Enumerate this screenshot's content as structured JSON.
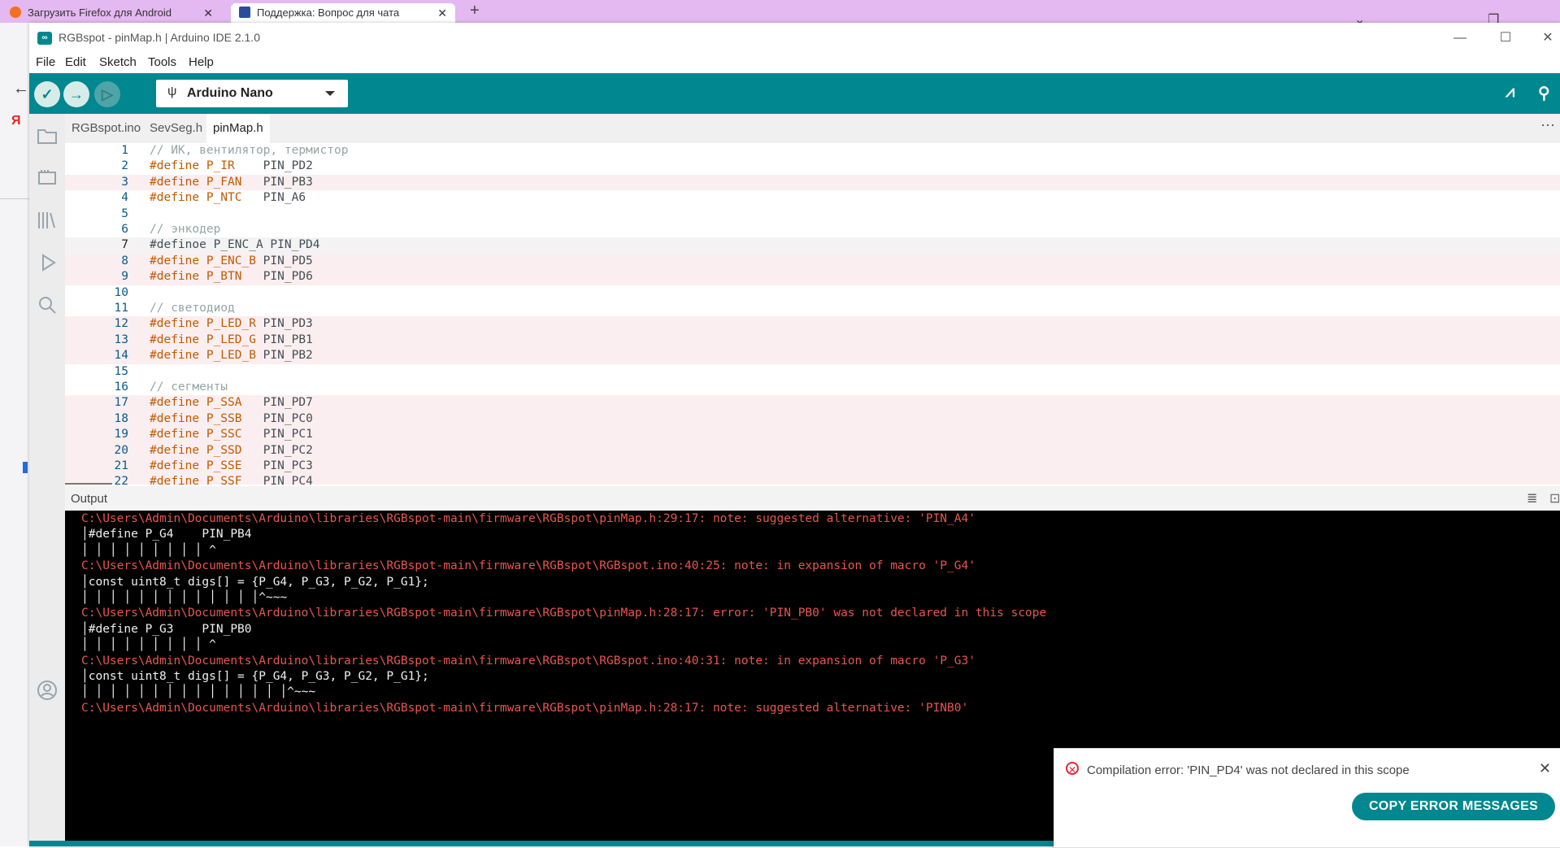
{
  "browser": {
    "tab1_title": "Загрузить Firefox для Android",
    "tab2_title": "Поддержка: Вопрос для чата",
    "tab_close": "✕",
    "new_tab": "+"
  },
  "window": {
    "title": "RGBspot - pinMap.h | Arduino IDE 2.1.0",
    "app_badge": "∞"
  },
  "menu": [
    "File",
    "Edit",
    "Sketch",
    "Tools",
    "Help"
  ],
  "toolbar": {
    "board": "Arduino Nano"
  },
  "tabs": [
    {
      "label": "RGBspot.ino",
      "active": false
    },
    {
      "label": "SevSeg.h",
      "active": false
    },
    {
      "label": "pinMap.h",
      "active": true
    }
  ],
  "editor": {
    "lines": [
      {
        "n": "1",
        "kw": "",
        "text": "// ИК, вентилятор, термистор",
        "kind": "comment",
        "err": false
      },
      {
        "n": "2",
        "kw": "#define",
        "mac": " P_IR",
        "rest": "    PIN_PD2",
        "kind": "define",
        "err": false
      },
      {
        "n": "3",
        "kw": "#define",
        "mac": " P_FAN",
        "rest": "   PIN_PB3",
        "kind": "define",
        "err": true
      },
      {
        "n": "4",
        "kw": "#define",
        "mac": " P_NTC",
        "rest": "   PIN_A6",
        "kind": "define",
        "err": false
      },
      {
        "n": "5",
        "kw": "",
        "text": "",
        "kind": "blank",
        "err": false
      },
      {
        "n": "6",
        "kw": "",
        "text": "// энкодер",
        "kind": "comment",
        "err": false
      },
      {
        "n": "7",
        "kw": "",
        "text": "#definoe P_ENC_A PIN_PD4",
        "kind": "plain",
        "err": false,
        "cur": true
      },
      {
        "n": "8",
        "kw": "#define",
        "mac": " P_ENC_B",
        "rest": " PIN_PD5",
        "kind": "define",
        "err": true
      },
      {
        "n": "9",
        "kw": "#define",
        "mac": " P_BTN",
        "rest": "   PIN_PD6",
        "kind": "define",
        "err": true
      },
      {
        "n": "10",
        "kw": "",
        "text": "",
        "kind": "blank",
        "err": false
      },
      {
        "n": "11",
        "kw": "",
        "text": "// светодиод",
        "kind": "comment",
        "err": false
      },
      {
        "n": "12",
        "kw": "#define",
        "mac": " P_LED_R",
        "rest": " PIN_PD3",
        "kind": "define",
        "err": true
      },
      {
        "n": "13",
        "kw": "#define",
        "mac": " P_LED_G",
        "rest": " PIN_PB1",
        "kind": "define",
        "err": true
      },
      {
        "n": "14",
        "kw": "#define",
        "mac": " P_LED_B",
        "rest": " PIN_PB2",
        "kind": "define",
        "err": true
      },
      {
        "n": "15",
        "kw": "",
        "text": "",
        "kind": "blank",
        "err": false
      },
      {
        "n": "16",
        "kw": "",
        "text": "// сегменты",
        "kind": "comment",
        "err": false
      },
      {
        "n": "17",
        "kw": "#define",
        "mac": " P_SSA",
        "rest": "   PIN_PD7",
        "kind": "define",
        "err": true
      },
      {
        "n": "18",
        "kw": "#define",
        "mac": " P_SSB",
        "rest": "   PIN_PC0",
        "kind": "define",
        "err": true
      },
      {
        "n": "19",
        "kw": "#define",
        "mac": " P_SSC",
        "rest": "   PIN_PC1",
        "kind": "define",
        "err": true
      },
      {
        "n": "20",
        "kw": "#define",
        "mac": " P_SSD",
        "rest": "   PIN_PC2",
        "kind": "define",
        "err": true
      },
      {
        "n": "21",
        "kw": "#define",
        "mac": " P_SSE",
        "rest": "   PIN_PC3",
        "kind": "define",
        "err": true
      },
      {
        "n": "22",
        "kw": "#define",
        "mac": " P_SSF",
        "rest": "   PIN_PC4",
        "kind": "define",
        "err": true
      }
    ]
  },
  "output": {
    "title": "Output",
    "lines": [
      {
        "cls": "red",
        "text": "C:\\Users\\Admin\\Documents\\Arduino\\libraries\\RGBspot-main\\firmware\\RGBspot\\pinMap.h:29:17: note: suggested alternative: 'PIN_A4'"
      },
      {
        "cls": "white",
        "text": "│#define P_G4    PIN_PB4"
      },
      {
        "cls": "white",
        "text": "│ │ │ │ │ │ │ │ │ ^"
      },
      {
        "cls": "red",
        "text": "C:\\Users\\Admin\\Documents\\Arduino\\libraries\\RGBspot-main\\firmware\\RGBspot\\RGBspot.ino:40:25: note: in expansion of macro 'P_G4'"
      },
      {
        "cls": "white",
        "text": "│const uint8_t digs[] = {P_G4, P_G3, P_G2, P_G1};"
      },
      {
        "cls": "white",
        "text": "│ │ │ │ │ │ │ │ │ │ │ │ │^~~~"
      },
      {
        "cls": "red",
        "text": "C:\\Users\\Admin\\Documents\\Arduino\\libraries\\RGBspot-main\\firmware\\RGBspot\\pinMap.h:28:17: error: 'PIN_PB0' was not declared in this scope"
      },
      {
        "cls": "white",
        "text": "│#define P_G3    PIN_PB0"
      },
      {
        "cls": "white",
        "text": "│ │ │ │ │ │ │ │ │ ^"
      },
      {
        "cls": "red",
        "text": "C:\\Users\\Admin\\Documents\\Arduino\\libraries\\RGBspot-main\\firmware\\RGBspot\\RGBspot.ino:40:31: note: in expansion of macro 'P_G3'"
      },
      {
        "cls": "white",
        "text": "│const uint8_t digs[] = {P_G4, P_G3, P_G2, P_G1};"
      },
      {
        "cls": "white",
        "text": "│ │ │ │ │ │ │ │ │ │ │ │ │ │ │^~~~"
      },
      {
        "cls": "red",
        "text": "C:\\Users\\Admin\\Documents\\Arduino\\libraries\\RGBspot-main\\firmware\\RGBspot\\pinMap.h:28:17: note: suggested alternative: 'PINB0'"
      }
    ]
  },
  "notification": {
    "message": "Compilation error: 'PIN_PD4' was not declared in this scope",
    "button": "COPY ERROR MESSAGES",
    "close": "✕"
  },
  "colors": {
    "accent": "#00878f",
    "error": "#e9554e"
  }
}
